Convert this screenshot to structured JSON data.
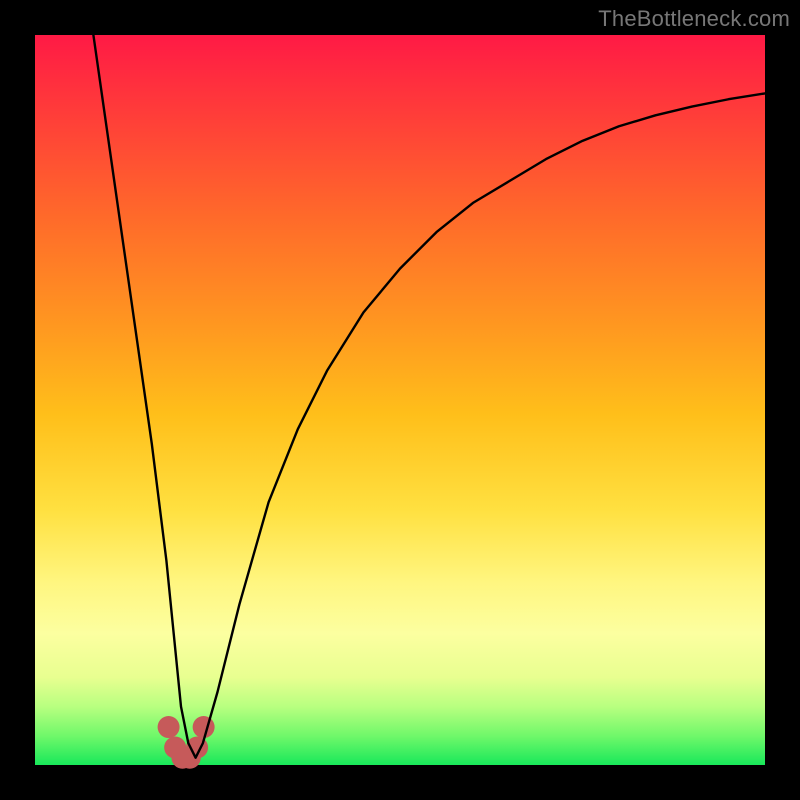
{
  "watermark": "TheBottleneck.com",
  "chart_data": {
    "type": "line",
    "title": "",
    "xlabel": "",
    "ylabel": "",
    "xlim": [
      0,
      100
    ],
    "ylim": [
      0,
      100
    ],
    "grid": false,
    "series": [
      {
        "name": "curve",
        "x": [
          8,
          10,
          12,
          14,
          16,
          18,
          19,
          20,
          21,
          22,
          23,
          25,
          28,
          32,
          36,
          40,
          45,
          50,
          55,
          60,
          65,
          70,
          75,
          80,
          85,
          90,
          95,
          100
        ],
        "values": [
          100,
          86,
          72,
          58,
          44,
          28,
          18,
          8,
          3,
          1,
          3,
          10,
          22,
          36,
          46,
          54,
          62,
          68,
          73,
          77,
          80,
          83,
          85.5,
          87.5,
          89,
          90.2,
          91.2,
          92
        ]
      }
    ],
    "markers": [
      {
        "x": 18.3,
        "y": 5.2
      },
      {
        "x": 19.2,
        "y": 2.4
      },
      {
        "x": 20.2,
        "y": 1.0
      },
      {
        "x": 21.2,
        "y": 1.0
      },
      {
        "x": 22.2,
        "y": 2.4
      },
      {
        "x": 23.1,
        "y": 5.2
      }
    ],
    "colors": {
      "curve": "#000000",
      "markers": "#c65a5a",
      "bg_top": "#ff1a45",
      "bg_bottom": "#18e85a"
    }
  }
}
